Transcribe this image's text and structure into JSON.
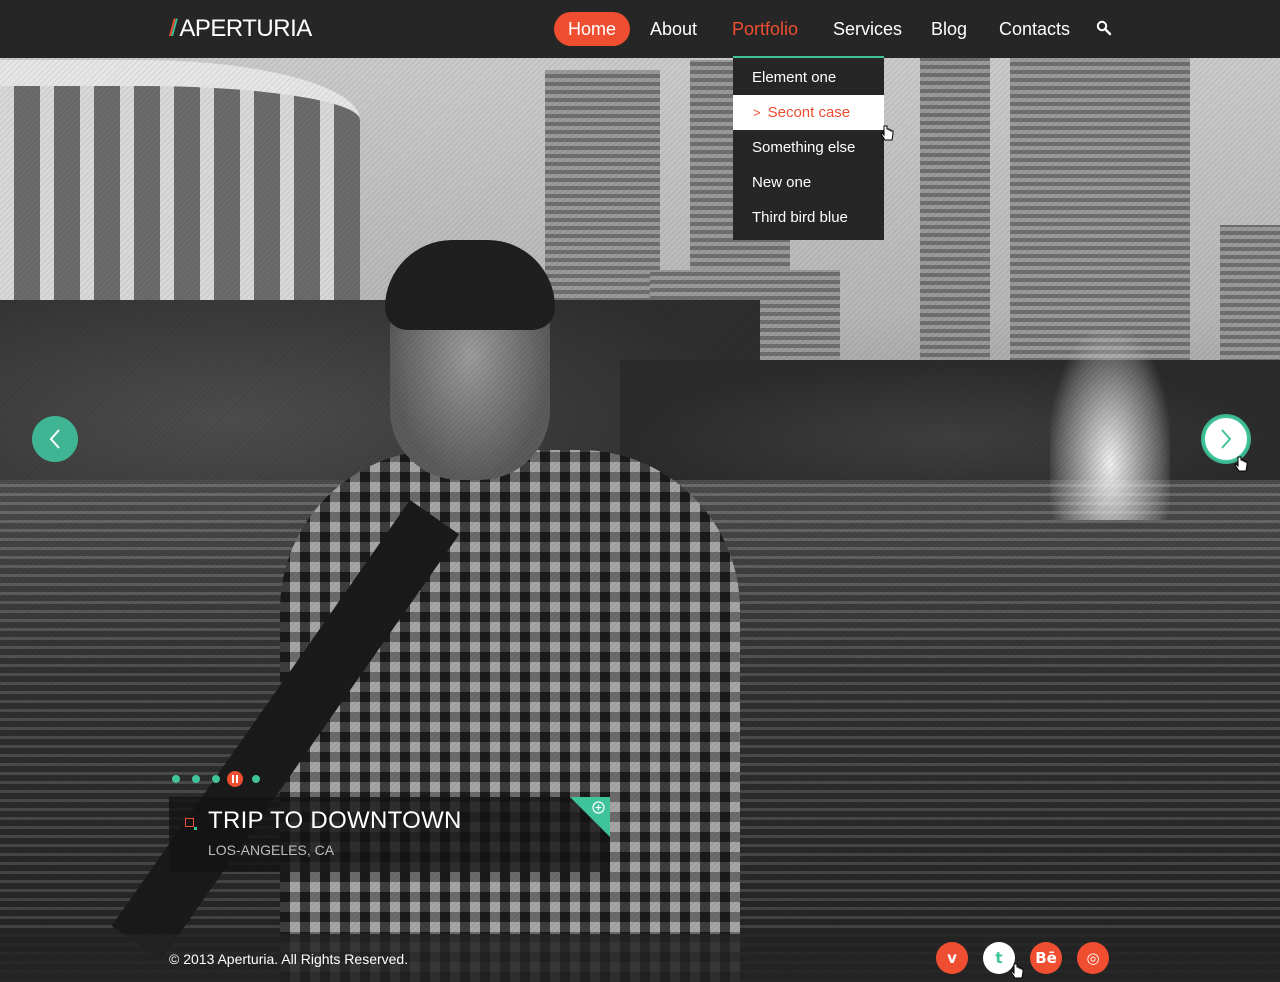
{
  "brand": {
    "name": "APERTURIA",
    "accent": "#f04e30",
    "secondary": "#3fc39a"
  },
  "nav": {
    "items": [
      {
        "label": "Home",
        "state": "active"
      },
      {
        "label": "About",
        "state": "normal"
      },
      {
        "label": "Portfolio",
        "state": "hover"
      },
      {
        "label": "Services",
        "state": "normal"
      },
      {
        "label": "Blog",
        "state": "normal"
      },
      {
        "label": "Contacts",
        "state": "normal"
      }
    ],
    "search_icon": "search-icon"
  },
  "dropdown": {
    "items": [
      {
        "label": "Element one"
      },
      {
        "label": "Secont case",
        "selected": true
      },
      {
        "label": "Something else"
      },
      {
        "label": "New one"
      },
      {
        "label": "Third bird blue"
      }
    ]
  },
  "slider": {
    "prev_icon": "chevron-left-icon",
    "next_icon": "chevron-right-icon",
    "dots_count": 5,
    "current_dot": 4,
    "caption": {
      "title": "TRIP TO DOWNTOWN",
      "subtitle": "LOS-ANGELES, CA",
      "action_icon": "plus-circle-icon"
    }
  },
  "footer": {
    "copyright": "© 2013 Aperturia. All Rights Reserved.",
    "social": [
      {
        "name": "vimeo",
        "glyph": "v"
      },
      {
        "name": "twitter",
        "glyph": "t"
      },
      {
        "name": "behance",
        "glyph": "Bē"
      },
      {
        "name": "dribbble",
        "glyph": "◎"
      }
    ]
  }
}
